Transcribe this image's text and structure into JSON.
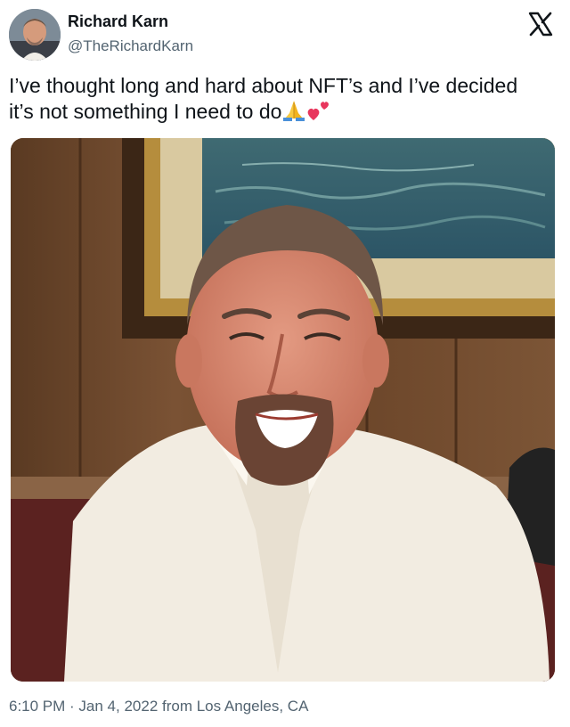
{
  "author": {
    "display_name": "Richard Karn",
    "handle": "@TheRichardKarn",
    "avatar_icon": "profile-photo"
  },
  "platform": {
    "logo_icon": "x-logo-icon"
  },
  "tweet": {
    "line1": "I’ve thought long and hard about NFT’s and I’ve decided",
    "line2": "it’s not something I need to do",
    "emojis": [
      "folded-hands-emoji",
      "two-hearts-emoji"
    ]
  },
  "media": {
    "type": "photo",
    "subject": "man in white shirt smiling at restaurant booth"
  },
  "meta": {
    "timestamp": "6:10 PM · Jan 4, 2022 from Los Angeles, CA"
  }
}
